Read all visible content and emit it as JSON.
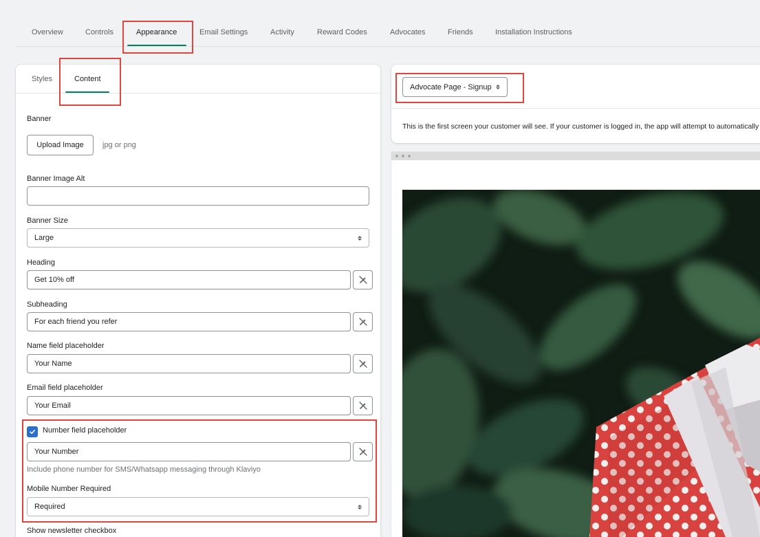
{
  "nav": {
    "tabs": [
      {
        "label": "Overview"
      },
      {
        "label": "Controls"
      },
      {
        "label": "Appearance"
      },
      {
        "label": "Email Settings"
      },
      {
        "label": "Activity"
      },
      {
        "label": "Reward Codes"
      },
      {
        "label": "Advocates"
      },
      {
        "label": "Friends"
      },
      {
        "label": "Installation Instructions"
      }
    ],
    "active_tab": "Appearance"
  },
  "content_panel": {
    "subtabs": [
      {
        "label": "Styles"
      },
      {
        "label": "Content"
      }
    ],
    "active_subtab": "Content",
    "banner": {
      "label": "Banner",
      "upload_button": "Upload Image",
      "file_hint": "jpg or png"
    },
    "banner_alt": {
      "label": "Banner Image Alt",
      "value": ""
    },
    "banner_size": {
      "label": "Banner Size",
      "value": "Large"
    },
    "heading": {
      "label": "Heading",
      "value": "Get 10% off"
    },
    "subheading": {
      "label": "Subheading",
      "value": "For each friend you refer"
    },
    "name_field": {
      "label": "Name field placeholder",
      "value": "Your Name"
    },
    "email_field": {
      "label": "Email field placeholder",
      "value": "Your Email"
    },
    "number_field": {
      "label": "Number field placeholder",
      "checked": true,
      "value": "Your Number",
      "help": "Include phone number for SMS/Whatsapp messaging through Klaviyo"
    },
    "mobile_required": {
      "label": "Mobile Number Required",
      "value": "Required"
    },
    "newsletter": {
      "label": "Show newsletter checkbox"
    }
  },
  "preview_panel": {
    "page_select": "Advocate Page - Signup",
    "description": "This is the first screen your customer will see. If your customer is logged in, the app will attempt to automatically fill in their details."
  },
  "colors": {
    "accent": "#008060",
    "highlight": "#e0443a",
    "checkbox": "#2c6ecb",
    "gift_red": "#d8433f"
  },
  "icons": {
    "input_action": "magic-wand-off-icon",
    "checkbox": "check-icon",
    "select": "chevron-updown-icon"
  }
}
